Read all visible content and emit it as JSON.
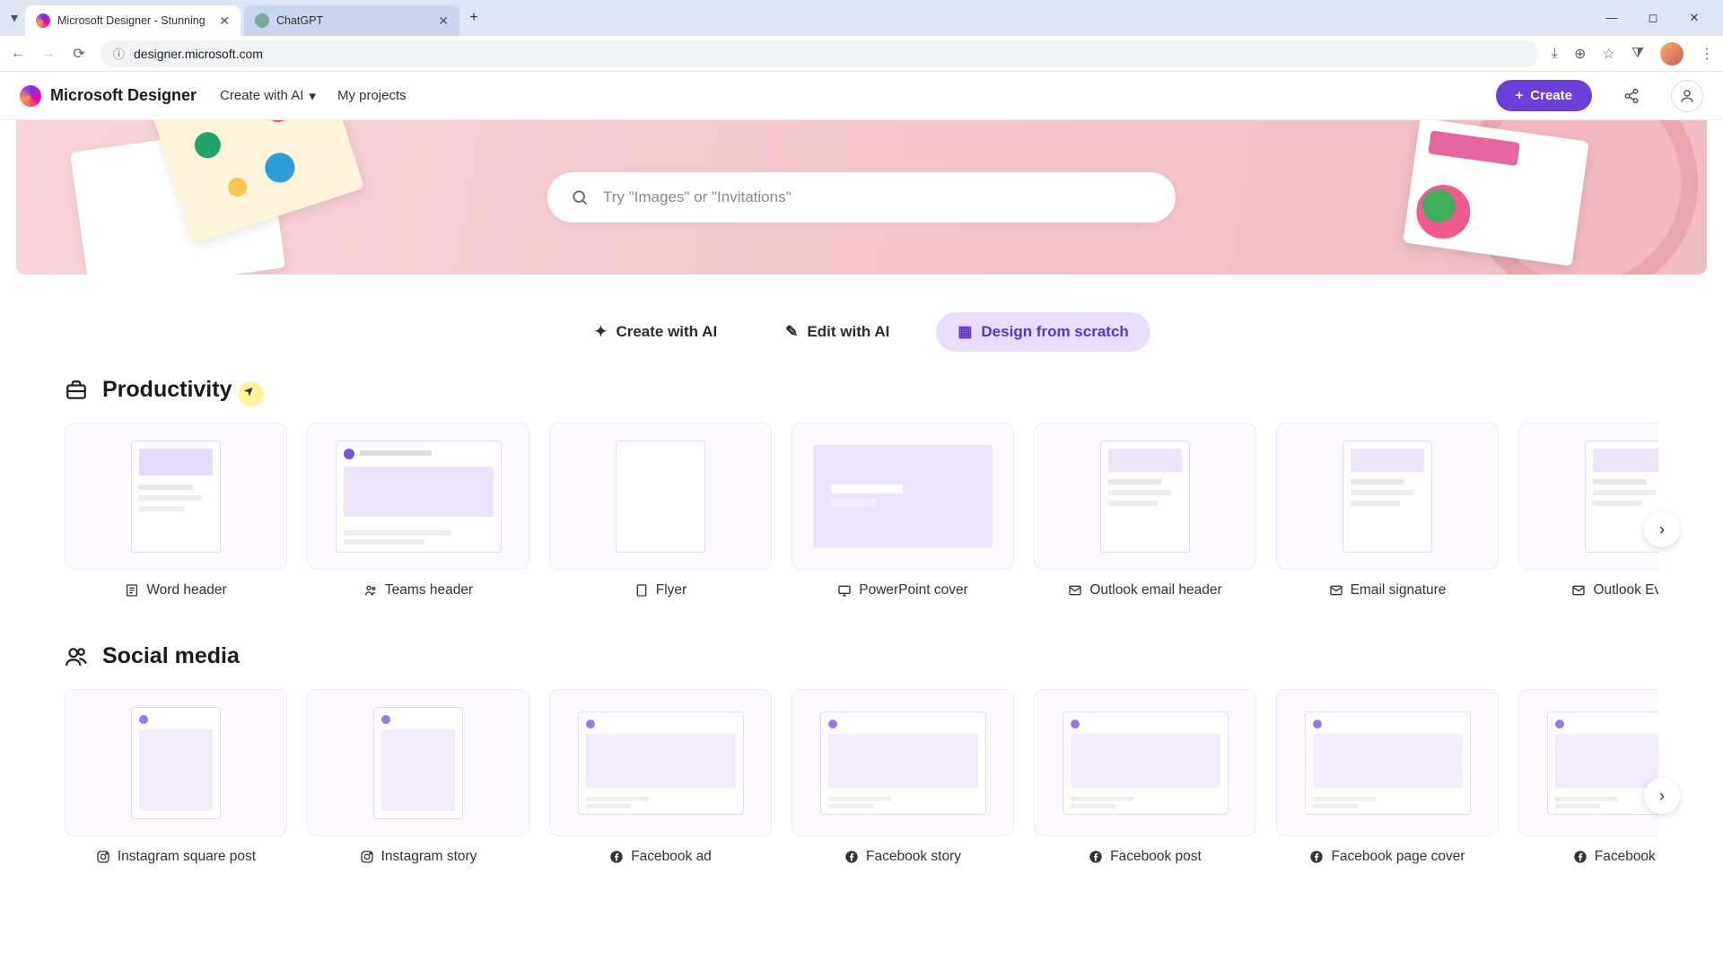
{
  "browser": {
    "tabs": [
      {
        "title": "Microsoft Designer - Stunning",
        "active": true
      },
      {
        "title": "ChatGPT",
        "active": false
      }
    ],
    "url": "designer.microsoft.com"
  },
  "app": {
    "name": "Microsoft Designer",
    "nav": {
      "create_with_ai": "Create with AI",
      "my_projects": "My projects"
    },
    "create_button": "Create"
  },
  "hero": {
    "search_placeholder": "Try \"Images\" or \"Invitations\""
  },
  "actions": {
    "create_ai": "Create with AI",
    "edit_ai": "Edit with AI",
    "scratch": "Design from scratch"
  },
  "sections": [
    {
      "id": "productivity",
      "title": "Productivity",
      "items": [
        {
          "label": "Word header",
          "icon": "word"
        },
        {
          "label": "Teams header",
          "icon": "teams"
        },
        {
          "label": "Flyer",
          "icon": "doc"
        },
        {
          "label": "PowerPoint cover",
          "icon": "ppt"
        },
        {
          "label": "Outlook email header",
          "icon": "mail"
        },
        {
          "label": "Email signature",
          "icon": "mail"
        },
        {
          "label": "Outlook Eventif",
          "icon": "mail"
        }
      ]
    },
    {
      "id": "social",
      "title": "Social media",
      "items": [
        {
          "label": "Instagram square post",
          "icon": "ig"
        },
        {
          "label": "Instagram story",
          "icon": "ig"
        },
        {
          "label": "Facebook ad",
          "icon": "fb"
        },
        {
          "label": "Facebook story",
          "icon": "fb"
        },
        {
          "label": "Facebook post",
          "icon": "fb"
        },
        {
          "label": "Facebook page cover",
          "icon": "fb"
        },
        {
          "label": "Facebook ever",
          "icon": "fb"
        }
      ]
    }
  ]
}
